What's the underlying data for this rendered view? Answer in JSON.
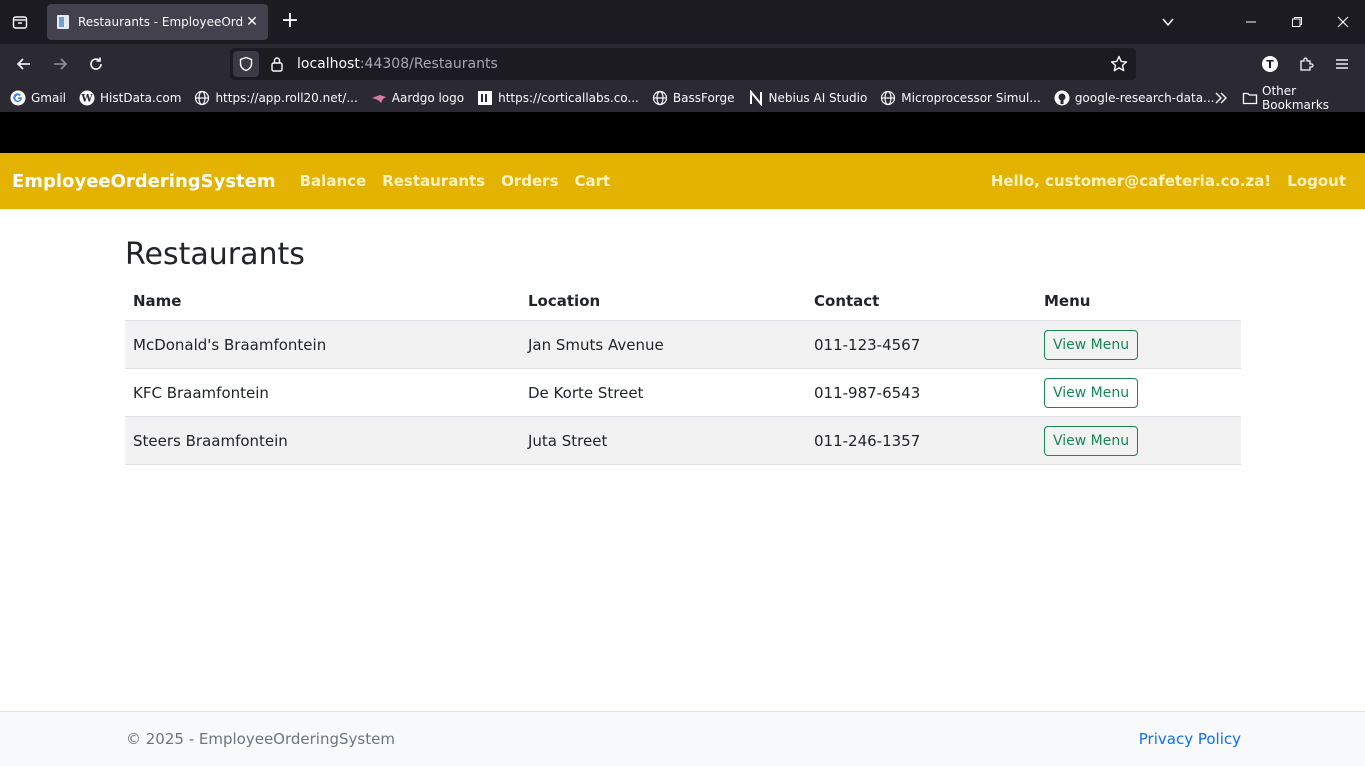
{
  "browser": {
    "tab_title": "Restaurants - EmployeeOrderingSystem",
    "url_host": "localhost",
    "url_path": ":44308/Restaurants",
    "bookmarks": [
      {
        "label": "Gmail",
        "icon": "gmail-icon"
      },
      {
        "label": "HistData.com",
        "icon": "wordpress-icon"
      },
      {
        "label": "https://app.roll20.net/...",
        "icon": "globe-icon"
      },
      {
        "label": "Aardgo logo",
        "icon": "aardgo-icon"
      },
      {
        "label": "https://corticallabs.co...",
        "icon": "corticallabs-icon"
      },
      {
        "label": "BassForge",
        "icon": "globe-icon"
      },
      {
        "label": "Nebius AI Studio",
        "icon": "nebius-icon"
      },
      {
        "label": "Microprocessor Simul...",
        "icon": "globe-icon"
      },
      {
        "label": "google-research-data...",
        "icon": "github-icon"
      }
    ],
    "other_bookmarks": "Other Bookmarks",
    "profile_initial": "T"
  },
  "app": {
    "brand": "EmployeeOrderingSystem",
    "nav": [
      "Balance",
      "Restaurants",
      "Orders",
      "Cart"
    ],
    "greeting": "Hello, customer@cafeteria.co.za!",
    "logout": "Logout",
    "colors": {
      "navbar": "#e4b200",
      "button": "#198754",
      "link": "#0d6efd"
    }
  },
  "page": {
    "title": "Restaurants",
    "columns": [
      "Name",
      "Location",
      "Contact",
      "Menu"
    ],
    "rows": [
      {
        "name": "McDonald's Braamfontein",
        "location": "Jan Smuts Avenue",
        "contact": "011-123-4567",
        "action": "View Menu"
      },
      {
        "name": "KFC Braamfontein",
        "location": "De Korte Street",
        "contact": "011-987-6543",
        "action": "View Menu"
      },
      {
        "name": "Steers Braamfontein",
        "location": "Juta Street",
        "contact": "011-246-1357",
        "action": "View Menu"
      }
    ]
  },
  "footer": {
    "copyright": "© 2025 - EmployeeOrderingSystem",
    "privacy": "Privacy Policy"
  }
}
